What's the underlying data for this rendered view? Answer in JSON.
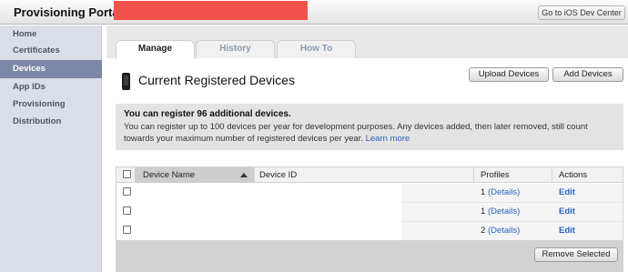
{
  "header": {
    "title": "Provisioning Portal :",
    "dev_center_label": "Go to iOS Dev Center"
  },
  "sidebar": {
    "items": [
      {
        "label": "Home"
      },
      {
        "label": "Certificates"
      },
      {
        "label": "Devices",
        "active": true
      },
      {
        "label": "App IDs"
      },
      {
        "label": "Provisioning"
      },
      {
        "label": "Distribution"
      }
    ]
  },
  "tabs": [
    {
      "label": "Manage",
      "active": true
    },
    {
      "label": "History"
    },
    {
      "label": "How To"
    }
  ],
  "main": {
    "title": "Current Registered Devices",
    "upload_button": "Upload Devices",
    "add_button": "Add Devices"
  },
  "notice": {
    "heading": "You can register 96 additional devices.",
    "body": "You can register up to 100 devices per year for development purposes. Any devices added, then later removed, still count towards your maximum number of registered devices per year.",
    "link": "Learn more"
  },
  "table": {
    "columns": {
      "device_name": "Device Name",
      "device_id": "Device ID",
      "profiles": "Profiles",
      "actions": "Actions"
    },
    "rows": [
      {
        "profiles_count": "1",
        "details": "(Details)",
        "action": "Edit"
      },
      {
        "profiles_count": "1",
        "details": "(Details)",
        "action": "Edit"
      },
      {
        "profiles_count": "2",
        "details": "(Details)",
        "action": "Edit"
      }
    ],
    "remove_button": "Remove Selected"
  },
  "colors": {
    "accent_link": "#2a62c4",
    "sidebar_active": "#7b88a6",
    "redaction": "#f2514b"
  },
  "icons": {
    "device": "iphone-icon",
    "sort": "sort-ascending-icon"
  }
}
